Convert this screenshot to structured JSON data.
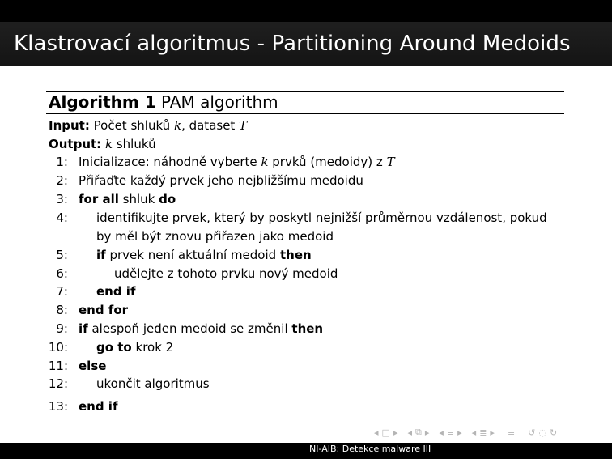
{
  "slide_title": "Klastrovací algoritmus - Partitioning Around Medoids",
  "algorithm": {
    "label": "Algorithm 1",
    "name": "PAM algorithm",
    "input_label": "Input:",
    "input_text_a": "Počet shluků",
    "input_var_k": "k",
    "input_text_b": ", dataset",
    "input_var_t": "T",
    "output_label": "Output:",
    "output_var_k": "k",
    "output_text": "shluků",
    "lines": [
      {
        "num": "1:",
        "a": "Inicializace: náhodně vyberte",
        "k": "k",
        "b": "prvků (medoidy) z",
        "t": "T"
      },
      {
        "num": "2:",
        "text": "Přiřaďte každý prvek jeho nejbližšímu medoidu"
      },
      {
        "num": "3:",
        "kw1": "for all",
        "text": "shluk",
        "kw2": "do"
      },
      {
        "num": "4:",
        "text": "identifikujte prvek, který by poskytl nejnižší průměrnou vzdálenost, pokud",
        "cont": "by měl být znovu přiřazen jako medoid"
      },
      {
        "num": "5:",
        "kw1": "if",
        "text": "prvek není aktuální medoid",
        "kw2": "then"
      },
      {
        "num": "6:",
        "text": "udělejte z tohoto prvku nový medoid"
      },
      {
        "num": "7:",
        "kw": "end if"
      },
      {
        "num": "8:",
        "kw": "end for"
      },
      {
        "num": "9:",
        "kw1": "if",
        "text": "alespoň jeden medoid se změnil",
        "kw2": "then"
      },
      {
        "num": "10:",
        "kw": "go to",
        "text": "krok 2"
      },
      {
        "num": "11:",
        "kw": "else"
      },
      {
        "num": "12:",
        "text": "ukončit algoritmus"
      },
      {
        "num": "13:",
        "kw": "end if"
      }
    ]
  },
  "footer": "NI-AIB: Detekce malware III",
  "colors": {
    "bar": "#000000",
    "title_bar": "#1a1a1a",
    "title_text": "#ffffff",
    "nav": "#b4b4b4"
  }
}
